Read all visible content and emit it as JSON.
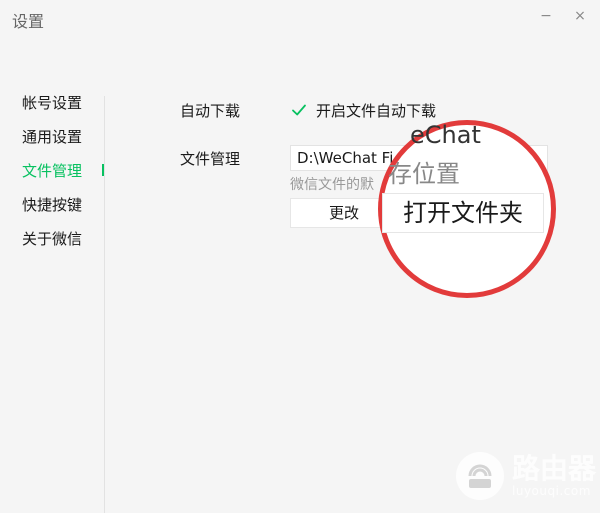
{
  "window": {
    "title": "设置",
    "minimize": "−",
    "close": "×"
  },
  "sidebar": {
    "items": [
      {
        "label": "帐号设置",
        "active": false
      },
      {
        "label": "通用设置",
        "active": false
      },
      {
        "label": "文件管理",
        "active": true
      },
      {
        "label": "快捷按键",
        "active": false
      },
      {
        "label": "关于微信",
        "active": false
      }
    ]
  },
  "settings": {
    "auto_download_label": "自动下载",
    "auto_download_checkbox": "开启文件自动下载",
    "auto_download_checked": true,
    "file_manage_label": "文件管理",
    "path_value": "D:\\WeChat Fi",
    "hint": "微信文件的默",
    "change_button": "更改"
  },
  "magnifier": {
    "zoom_top": "eChat",
    "zoom_hint": "存位置",
    "open_folder_button": "打开文件夹"
  },
  "watermark": {
    "brand": "路由器",
    "url": "luyouqi.com"
  },
  "colors": {
    "accent": "#07c160",
    "highlight_circle": "#e23b3b"
  },
  "icons": {
    "check": "check-icon",
    "router": "router-icon"
  }
}
